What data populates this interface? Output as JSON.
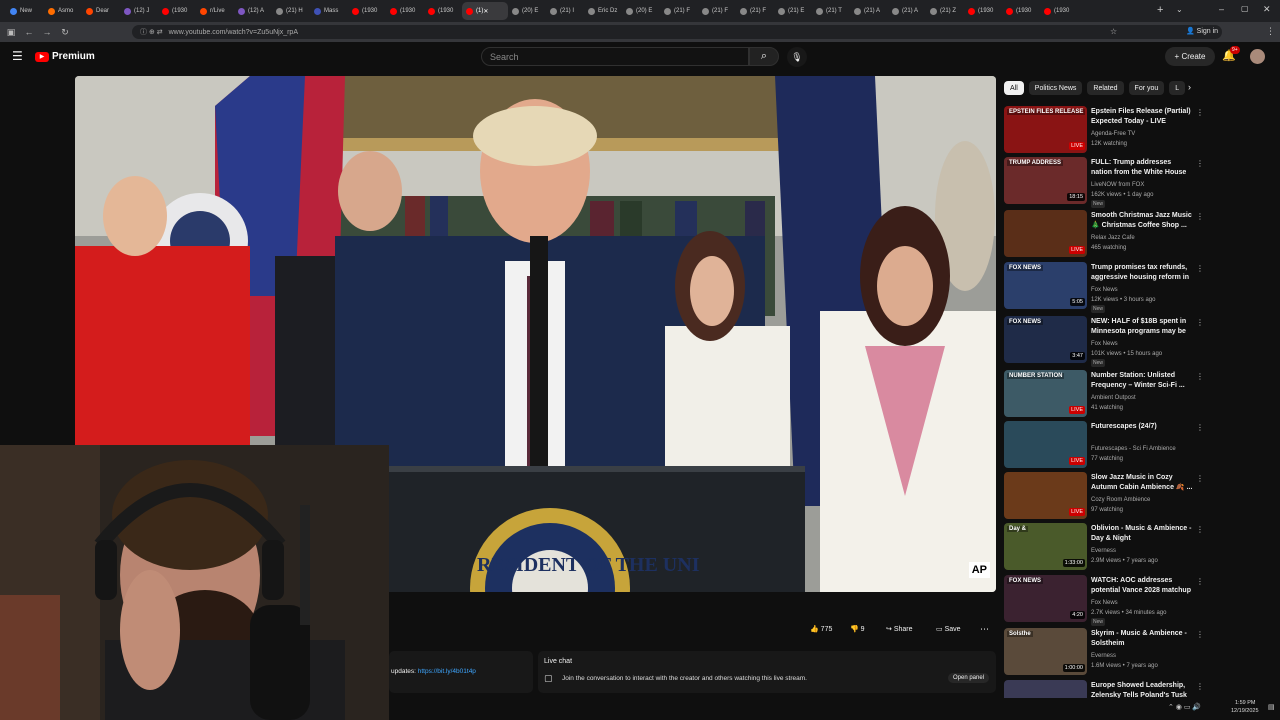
{
  "browser": {
    "tabs": [
      {
        "label": "New",
        "color": "#4285f4"
      },
      {
        "label": "Asmo",
        "color": "#ff6d00"
      },
      {
        "label": "Dear",
        "color": "#ff4500"
      },
      {
        "label": "(12) J",
        "color": "#7e57c2"
      },
      {
        "label": "(1930",
        "color": "#ff0000"
      },
      {
        "label": "r/Live",
        "color": "#ff4500"
      },
      {
        "label": "(12) A",
        "color": "#7e57c2"
      },
      {
        "label": "(21) H",
        "color": "#888888"
      },
      {
        "label": "Mass",
        "color": "#3f51b5"
      },
      {
        "label": "(1930",
        "color": "#ff0000"
      },
      {
        "label": "(1930",
        "color": "#ff0000"
      },
      {
        "label": "(1930",
        "color": "#ff0000"
      },
      {
        "label": "(1)",
        "color": "#ff0000",
        "active": true
      },
      {
        "label": "(20) E",
        "color": "#888888"
      },
      {
        "label": "(21) I",
        "color": "#888888"
      },
      {
        "label": "Eric Dz",
        "color": "#888888"
      },
      {
        "label": "(20) E",
        "color": "#888888"
      },
      {
        "label": "(21) F",
        "color": "#888888"
      },
      {
        "label": "(21) F",
        "color": "#888888"
      },
      {
        "label": "(21) F",
        "color": "#888888"
      },
      {
        "label": "(21) E",
        "color": "#888888"
      },
      {
        "label": "(21) T",
        "color": "#888888"
      },
      {
        "label": "(21) A",
        "color": "#888888"
      },
      {
        "label": "(21) A",
        "color": "#888888"
      },
      {
        "label": "(21) Z",
        "color": "#888888"
      },
      {
        "label": "(1930",
        "color": "#ff0000"
      },
      {
        "label": "(1930",
        "color": "#ff0000"
      },
      {
        "label": "(1930",
        "color": "#ff0000"
      }
    ],
    "url": "www.youtube.com/watch?v=Zu5uNjx_rpA",
    "signin_label": "Sign in"
  },
  "header": {
    "logo_text": "Premium",
    "search_placeholder": "Search",
    "create_label": "Create",
    "notif_count": "9+"
  },
  "video": {
    "watermark": "AP",
    "seal_text": "RESIDENT OF THE UNI"
  },
  "actions": {
    "likes": "775",
    "dislikes": "9",
    "share_label": "Share",
    "save_label": "Save"
  },
  "description": {
    "prefix": "updates: ",
    "link": "https://bit.ly/4b01t4p"
  },
  "livechat": {
    "title": "Live chat",
    "prompt": "Join the conversation to interact with the creator and others watching this live stream.",
    "open_panel_label": "Open panel"
  },
  "sidebar": {
    "chips": [
      {
        "label": "All",
        "selected": true
      },
      {
        "label": "Politics News"
      },
      {
        "label": "Related"
      },
      {
        "label": "For you"
      },
      {
        "label": "L"
      }
    ],
    "items": [
      {
        "title": "Epstein Files Release (Partial) Expected Today - LIVE Breakin...",
        "channel": "Agenda-Free TV",
        "meta": "12K watching",
        "badge": "LIVE",
        "live": true,
        "new": false,
        "thumb": "#8a1414",
        "thumb_text": "EPSTEIN FILES RELEASE"
      },
      {
        "title": "FULL: Trump addresses nation from the White House",
        "channel": "LiveNOW from FOX",
        "meta": "162K views • 1 day ago",
        "badge": "18:15",
        "live": false,
        "new": true,
        "thumb": "#6b2a2a",
        "thumb_text": "TRUMP ADDRESS"
      },
      {
        "title": "Smooth Christmas Jazz Music 🎄 Christmas Coffee Shop ...",
        "channel": "Relax Jazz Cafe",
        "meta": "465 watching",
        "badge": "LIVE",
        "live": true,
        "new": false,
        "thumb": "#5a2e18",
        "thumb_text": ""
      },
      {
        "title": "Trump promises tax refunds, aggressive housing reform in ...",
        "channel": "Fox News",
        "meta": "12K views • 3 hours ago",
        "badge": "5:05",
        "live": false,
        "new": true,
        "thumb": "#2b3f6b",
        "thumb_text": "FOX NEWS"
      },
      {
        "title": "NEW: HALF of $18B spent in Minnesota programs may be ...",
        "channel": "Fox News",
        "meta": "101K views • 15 hours ago",
        "badge": "3:47",
        "live": false,
        "new": true,
        "thumb": "#1f2b48",
        "thumb_text": "FOX NEWS"
      },
      {
        "title": "Number Station: Unlisted Frequency – Winter Sci-Fi ...",
        "channel": "Ambient Outpost",
        "meta": "41 watching",
        "badge": "LIVE",
        "live": true,
        "new": false,
        "thumb": "#3d5a66",
        "thumb_text": "NUMBER STATION"
      },
      {
        "title": "Futurescapes (24/7)",
        "channel": "Futurescapes - Sci Fi Ambience",
        "meta": "77 watching",
        "badge": "LIVE",
        "live": true,
        "new": false,
        "thumb": "#2a4a5a",
        "thumb_text": ""
      },
      {
        "title": "Slow Jazz Music in Cozy Autumn Cabin Ambience 🍂 ...",
        "channel": "Cozy Room Ambience",
        "meta": "97 watching",
        "badge": "LIVE",
        "live": true,
        "new": false,
        "thumb": "#6b3a1a",
        "thumb_text": ""
      },
      {
        "title": "Oblivion - Music & Ambience - Day & Night",
        "channel": "Everness",
        "meta": "2.9M views • 7 years ago",
        "badge": "1:33:00",
        "live": false,
        "new": false,
        "thumb": "#4a5a2a",
        "thumb_text": "Day &"
      },
      {
        "title": "WATCH: AOC addresses potential Vance 2028 matchup",
        "channel": "Fox News",
        "meta": "2.7K views • 34 minutes ago",
        "badge": "4:20",
        "live": false,
        "new": true,
        "thumb": "#3b2230",
        "thumb_text": "FOX NEWS"
      },
      {
        "title": "Skyrim - Music & Ambience - Solstheim",
        "channel": "Everness",
        "meta": "1.6M views • 7 years ago",
        "badge": "1:00:00",
        "live": false,
        "new": false,
        "thumb": "#5a4a3a",
        "thumb_text": "Solsthe"
      },
      {
        "title": "Europe Showed Leadership, Zelensky Tells Poland's Tusk ...",
        "channel": "",
        "meta": "",
        "badge": "",
        "live": false,
        "new": false,
        "thumb": "#3a3a55",
        "thumb_text": ""
      }
    ]
  },
  "taskbar": {
    "time": "1:59 PM",
    "date": "12/19/2025"
  },
  "colors": {
    "yt_red": "#ff0000",
    "live_red": "#cc0000",
    "link_blue": "#3ea6ff"
  }
}
